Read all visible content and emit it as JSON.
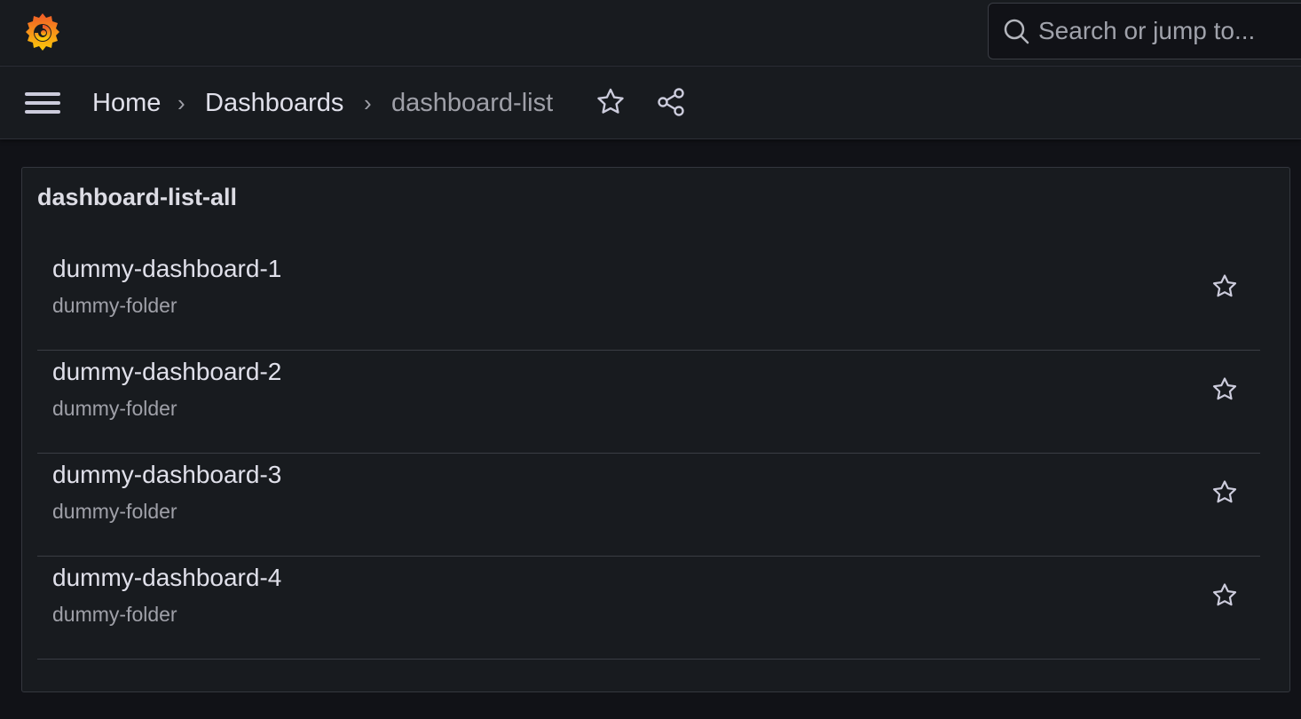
{
  "header": {
    "search_placeholder": "Search or jump to..."
  },
  "breadcrumbs": {
    "home": "Home",
    "sep1": "›",
    "dashboards": "Dashboards",
    "sep2": "›",
    "current": "dashboard-list"
  },
  "panel": {
    "title": "dashboard-list-all",
    "items": [
      {
        "title": "dummy-dashboard-1",
        "folder": "dummy-folder"
      },
      {
        "title": "dummy-dashboard-2",
        "folder": "dummy-folder"
      },
      {
        "title": "dummy-dashboard-3",
        "folder": "dummy-folder"
      },
      {
        "title": "dummy-dashboard-4",
        "folder": "dummy-folder"
      }
    ]
  },
  "icons": {
    "logo": "grafana-logo",
    "search": "search-icon",
    "menu": "hamburger-menu-icon",
    "favorite": "star-icon",
    "share": "share-icon"
  },
  "colors": {
    "background": "#111217",
    "surface": "#181b1f",
    "logo_orange": "#f05a28",
    "logo_yellow": "#fbca0a"
  }
}
